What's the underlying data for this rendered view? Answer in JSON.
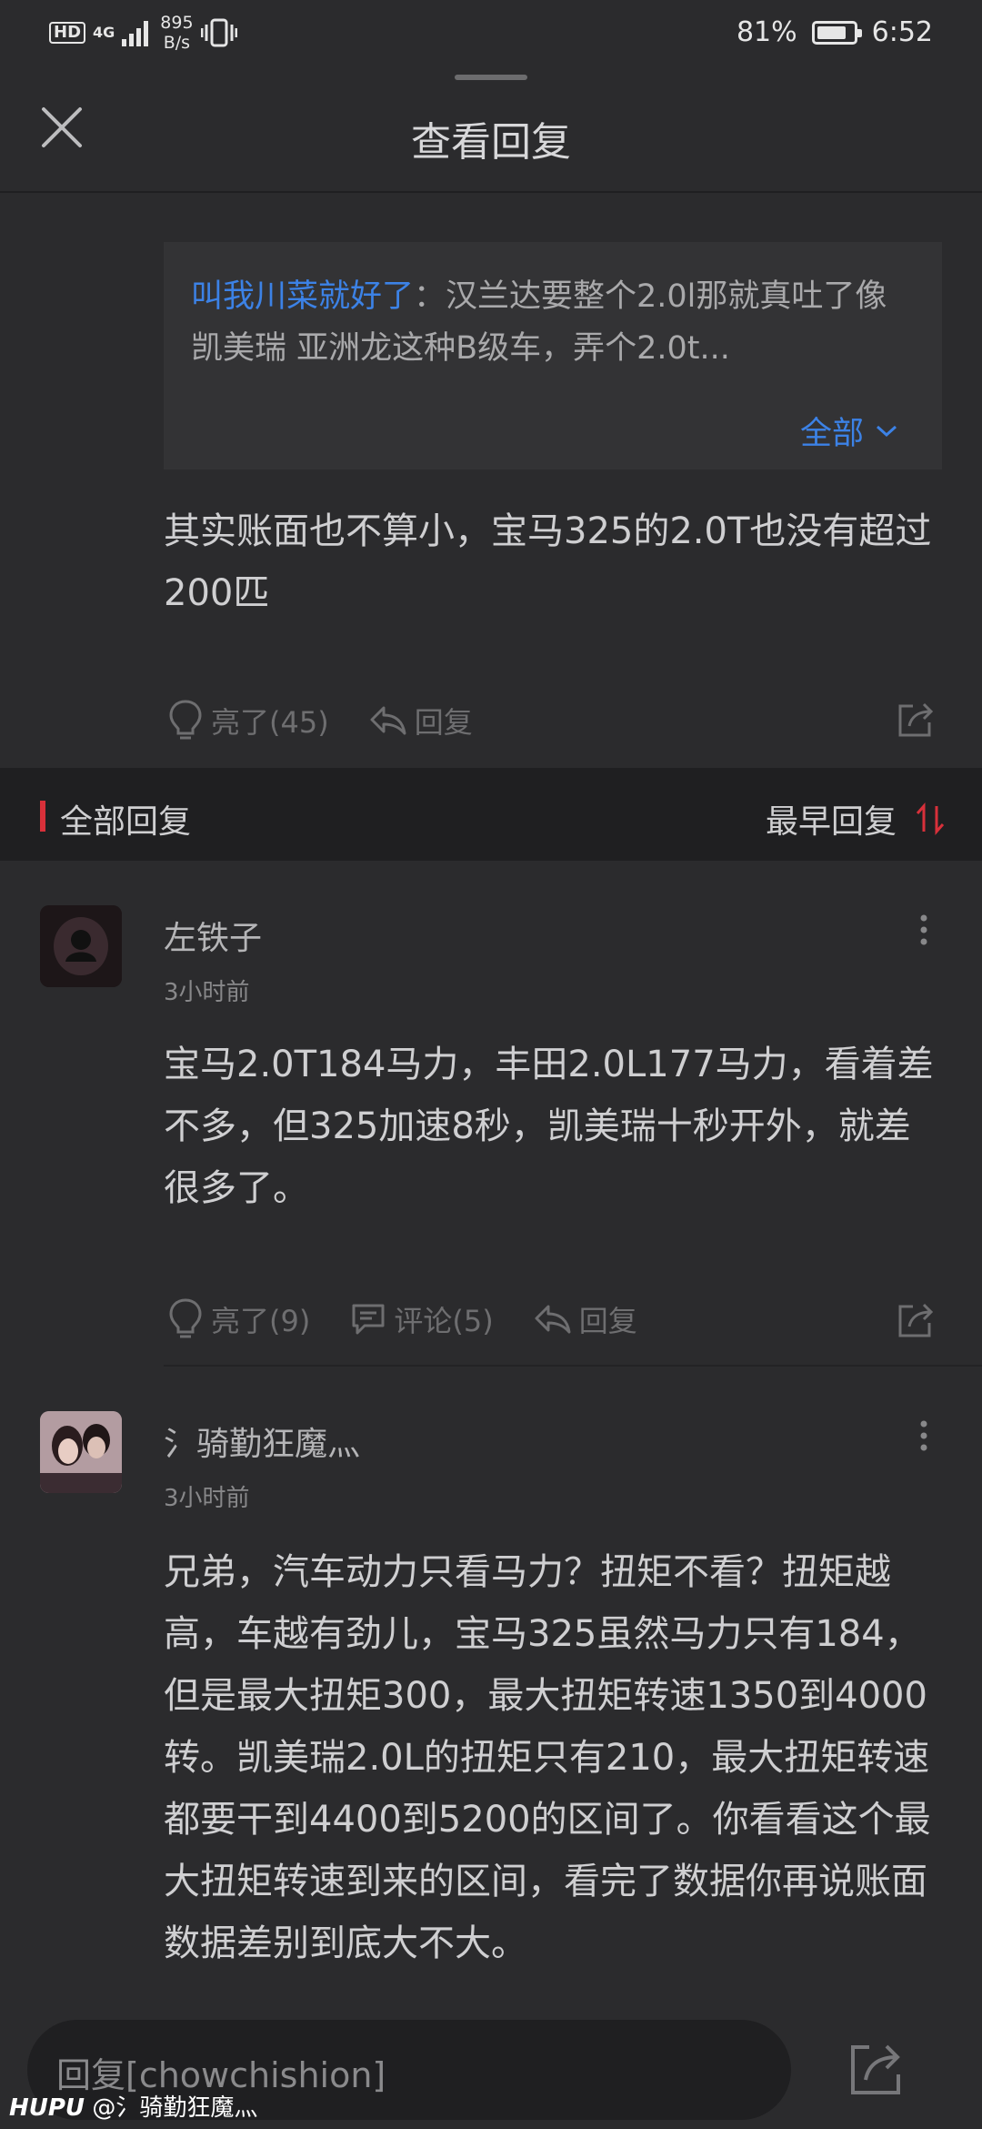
{
  "status_bar": {
    "hd": "HD",
    "network": "4G",
    "speed_value": "895",
    "speed_unit": "B/s",
    "battery_percent": "81%",
    "battery_level": 0.81,
    "time": "6:52"
  },
  "header": {
    "title": "查看回复"
  },
  "quoted_reply": {
    "user": "叫我川菜就好了",
    "text": "：汉兰达要整个2.0l那就真吐了像凯美瑞 亚洲龙这种B级车，弄个2.0t...",
    "expand_label": "全部"
  },
  "main_reply": {
    "text": "其实账面也不算小，宝马325的2.0T也没有超过200匹",
    "like_label": "亮了(45)",
    "reply_label": "回复"
  },
  "section": {
    "title": "全部回复",
    "sort_label": "最早回复"
  },
  "replies": [
    {
      "user": "左铁子",
      "time": "3小时前",
      "text": "宝马2.0T184马力，丰田2.0L177马力，看着差不多，但325加速8秒，凯美瑞十秒开外，就差很多了。",
      "like_label": "亮了(9)",
      "comment_label": "评论(5)",
      "reply_label": "回复"
    },
    {
      "user": "氵骑勤狂魔灬",
      "time": "3小时前",
      "text": "兄弟，汽车动力只看马力？扭矩不看？扭矩越高，车越有劲儿，宝马325虽然马力只有184，但是最大扭矩300，最大扭矩转速1350到4000转。凯美瑞2.0L的扭矩只有210，最大扭矩转速都要干到4400到5200的区间了。你看看这个最大扭矩转速到来的区间，看完了数据你再说账面数据差别到底大不大。"
    }
  ],
  "bottom_bar": {
    "placeholder": "回复[chowchishion]"
  },
  "watermark": {
    "brand": "HUPU",
    "handle": "@氵骑勤狂魔灬"
  },
  "colors": {
    "background": "#2b2b2d",
    "accent_blue": "#3c82e6",
    "accent_red": "#d8303a"
  }
}
